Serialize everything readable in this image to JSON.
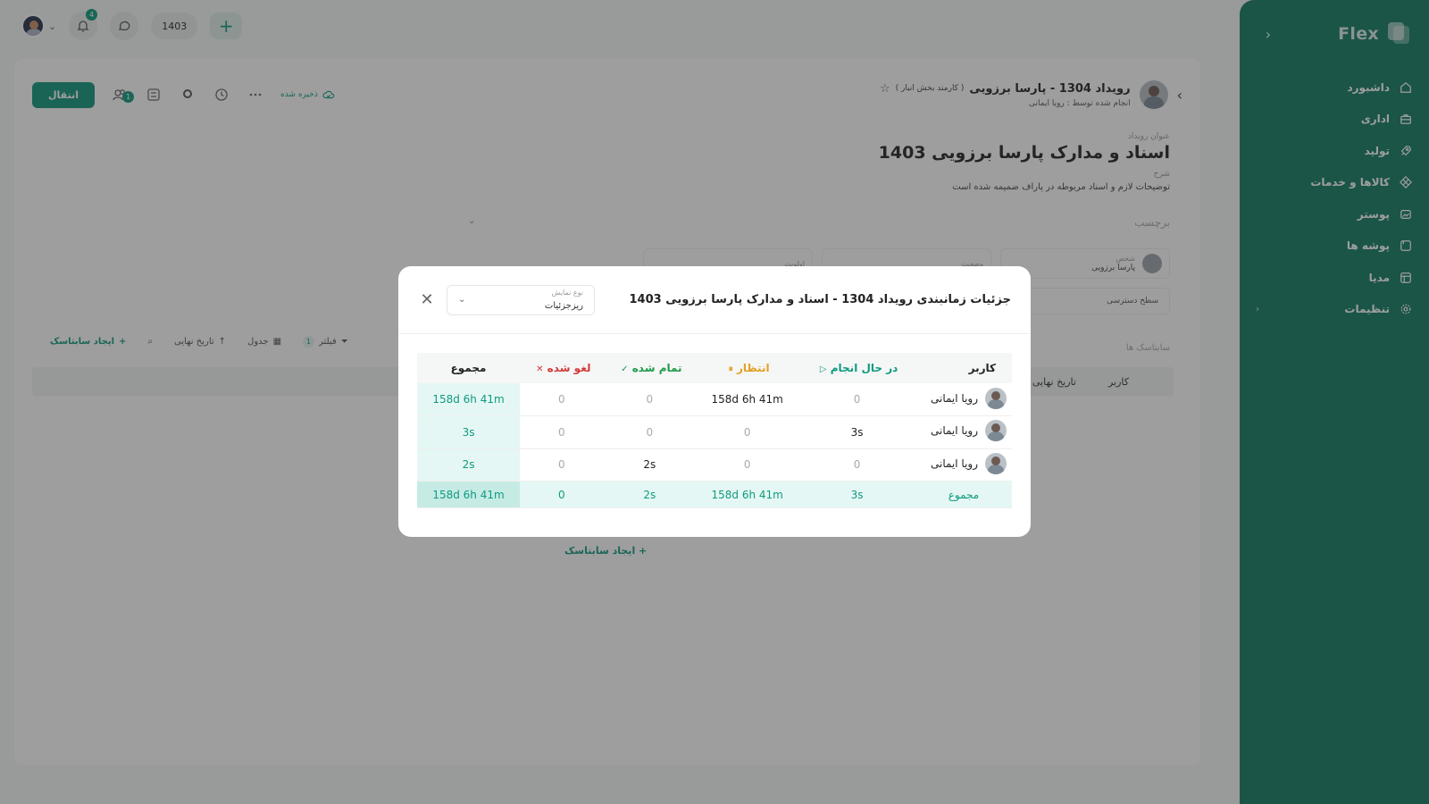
{
  "sidebar": {
    "brand": "Flex",
    "items": [
      {
        "label": "داشبورد",
        "icon": "home-icon"
      },
      {
        "label": "اداری",
        "icon": "briefcase-icon"
      },
      {
        "label": "تولید",
        "icon": "rocket-icon"
      },
      {
        "label": "کالاها و خدمات",
        "icon": "box-icon"
      },
      {
        "label": "پوستر",
        "icon": "image-icon"
      },
      {
        "label": "پوشه ها",
        "icon": "folder-icon"
      },
      {
        "label": "مدیا",
        "icon": "media-icon"
      },
      {
        "label": "تنظیمات",
        "icon": "gear-icon"
      }
    ]
  },
  "topbar": {
    "notifications_count": "4",
    "year": "1403"
  },
  "event": {
    "title": "رویداد 1304 - پارسا برزویی",
    "role": "( کارمند بخش انبار )",
    "done_by": "انجام شده توسط : رویا ایمانی",
    "saved": "ذخیره شده",
    "move_button": "انتقال",
    "tool_badge": "1",
    "title_label": "عنوان رویداد",
    "big_title": "اسناد و مدارک پارسا برزویی 1403",
    "desc_label": "شرح",
    "description": "توضیحات لازم و اسناد مربوطه در پاراف ضمیمه شده است",
    "tag_label": "برچسب",
    "person_label": "شخص",
    "person_name": "پارسا برزویی",
    "status_label": "وضعیت",
    "priority_label": "اولویت",
    "access_label": "سطح دسترسی"
  },
  "subtasks": {
    "label": "سابتاسک ها",
    "create": "ایجاد سابتاسک",
    "search": "",
    "deadline_sort": "تاریخ نهایی",
    "table_view": "جدول",
    "filter": "فیلتر",
    "filter_count": "1",
    "col_user": "کاربر",
    "col_deadline": "تاریخ نهایی",
    "create_bottom": "ایجاد سابتاسک"
  },
  "modal": {
    "title": "جزئیات زمانبندی رویداد 1304 - اسناد و مدارک پارسا برزویی 1403",
    "view_label": "نوع نمایش",
    "view_value": "ریزجزئیات",
    "headers": {
      "user": "کاربر",
      "in_progress": "در حال انجام",
      "waiting": "انتظار",
      "done": "تمام شده",
      "cancelled": "لغو شده",
      "total": "مجموع"
    },
    "rows": [
      {
        "user": "رویا ایمانی",
        "in_progress": "0",
        "waiting": "158d 6h 41m",
        "done": "0",
        "cancelled": "0",
        "total": "158d 6h 41m"
      },
      {
        "user": "رویا ایمانی",
        "in_progress": "3s",
        "waiting": "0",
        "done": "0",
        "cancelled": "0",
        "total": "3s"
      },
      {
        "user": "رویا ایمانی",
        "in_progress": "0",
        "waiting": "0",
        "done": "2s",
        "cancelled": "0",
        "total": "2s"
      }
    ],
    "sum": {
      "label": "مجموع",
      "in_progress": "3s",
      "waiting": "158d 6h 41m",
      "done": "2s",
      "cancelled": "0",
      "total": "158d 6h 41m"
    }
  }
}
